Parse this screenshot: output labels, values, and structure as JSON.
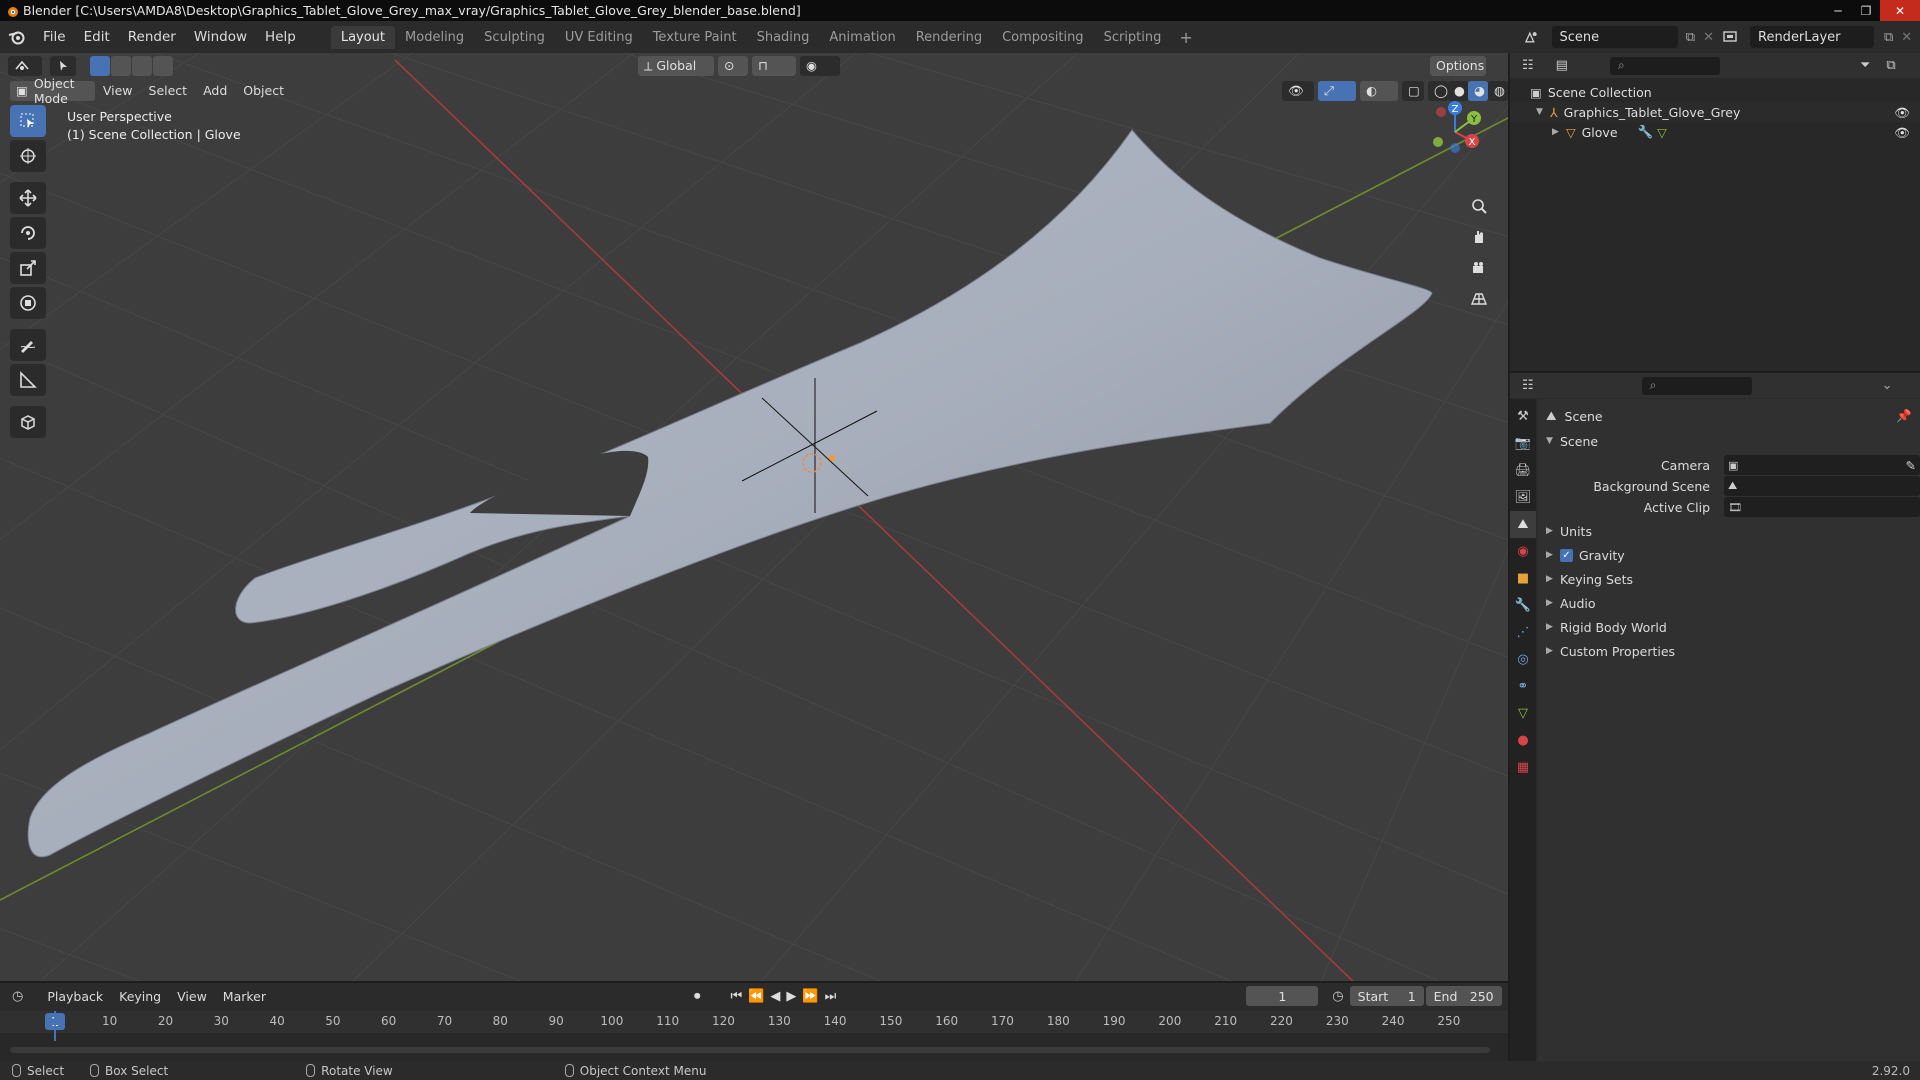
{
  "window": {
    "title": "Blender [C:\\Users\\AMDA8\\Desktop\\Graphics_Tablet_Glove_Grey_max_vray/Graphics_Tablet_Glove_Grey_blender_base.blend]",
    "minimize": "─",
    "maximize": "❐",
    "close": "✕"
  },
  "menu": [
    "File",
    "Edit",
    "Render",
    "Window",
    "Help"
  ],
  "workspaces": [
    "Layout",
    "Modeling",
    "Sculpting",
    "UV Editing",
    "Texture Paint",
    "Shading",
    "Animation",
    "Rendering",
    "Compositing",
    "Scripting"
  ],
  "workspace_active": "Layout",
  "scene_name": "Scene",
  "render_layer": "RenderLayer",
  "viewport": {
    "mode": "Object Mode",
    "menus": [
      "View",
      "Select",
      "Add",
      "Object"
    ],
    "transform_orientation": "Global",
    "options": "Options",
    "perspective": "User Perspective",
    "collection_info": "(1) Scene Collection | Glove"
  },
  "outliner": {
    "root": "Scene Collection",
    "collection": "Graphics_Tablet_Glove_Grey",
    "object": "Glove"
  },
  "properties": {
    "context": "Scene",
    "panel": "Scene",
    "camera_label": "Camera",
    "background_label": "Background Scene",
    "clip_label": "Active Clip",
    "subpanels": [
      "Units",
      "Gravity",
      "Keying Sets",
      "Audio",
      "Rigid Body World",
      "Custom Properties"
    ],
    "gravity_checked": true
  },
  "timeline": {
    "menus": [
      "Playback",
      "Keying",
      "View",
      "Marker"
    ],
    "current_frame": "1",
    "start_label": "Start",
    "start": "1",
    "end_label": "End",
    "end": "250",
    "ruler": [
      "10",
      "20",
      "30",
      "40",
      "50",
      "60",
      "70",
      "80",
      "90",
      "100",
      "110",
      "120",
      "130",
      "140",
      "150",
      "160",
      "170",
      "180",
      "190",
      "200",
      "210",
      "220",
      "230",
      "240",
      "250"
    ],
    "ruler_current": "1"
  },
  "status": {
    "select": "Select",
    "box_select": "Box Select",
    "rotate": "Rotate View",
    "context_menu": "Object Context Menu",
    "version": "2.92.0"
  },
  "colors": {
    "accent": "#4772b3",
    "x_axis": "#d64545",
    "y_axis": "#8bbf3f",
    "z_axis": "#3b7ddd"
  }
}
